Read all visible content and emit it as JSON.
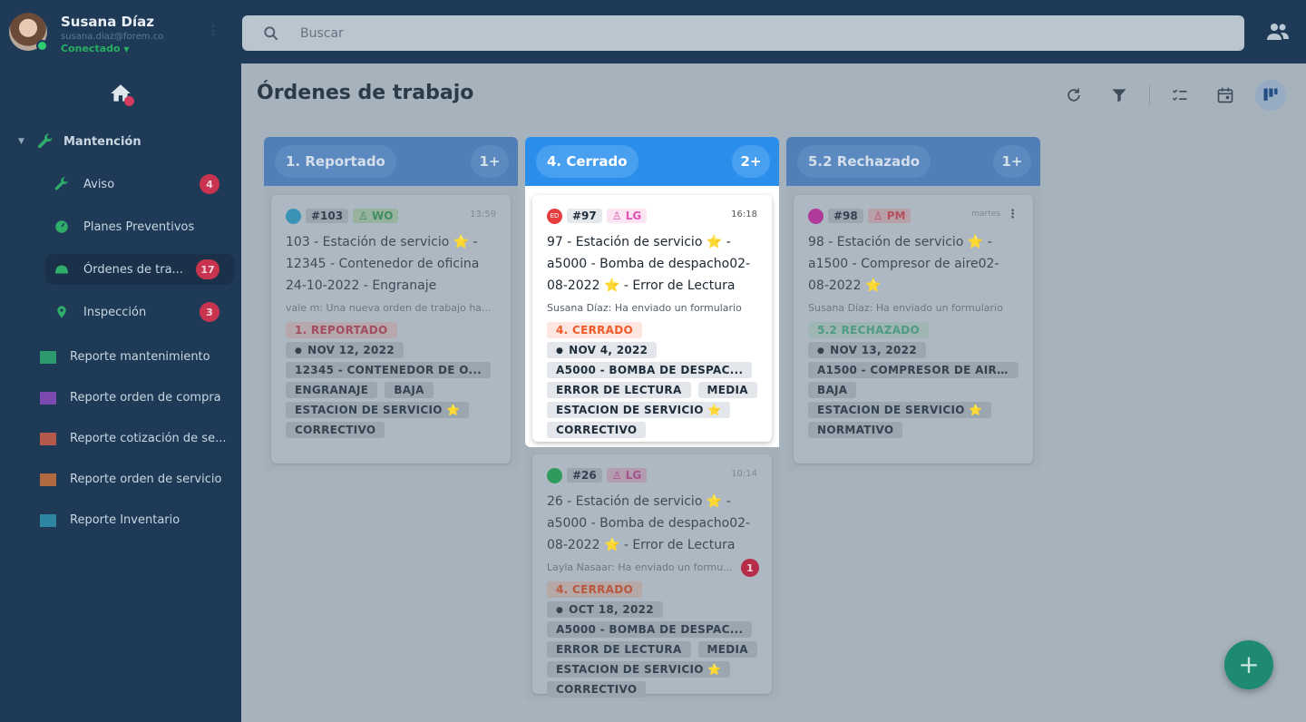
{
  "user": {
    "name": "Susana Díaz",
    "email": "susana.diaz@forem.co",
    "status": "Conectado"
  },
  "nav": {
    "section": "Mantención",
    "items": [
      {
        "label": "Aviso",
        "badge": "4"
      },
      {
        "label": "Planes Preventivos",
        "badge": ""
      },
      {
        "label": "Órdenes de tra...",
        "badge": "17"
      },
      {
        "label": "Inspección",
        "badge": "3"
      }
    ],
    "reports": [
      {
        "label": "Reporte mantenimiento",
        "color": "#2f9a6e"
      },
      {
        "label": "Reporte orden de compra",
        "color": "#7a4ab0"
      },
      {
        "label": "Reporte cotización de se...",
        "color": "#b35a4d"
      },
      {
        "label": "Reporte orden de servicio",
        "color": "#b06a3f"
      },
      {
        "label": "Reporte Inventario",
        "color": "#2f86a3"
      }
    ]
  },
  "search": {
    "placeholder": "Buscar"
  },
  "page": {
    "title": "Órdenes de trabajo"
  },
  "toolbar": {
    "icons": [
      "refresh-icon",
      "filter-icon",
      "list-icon",
      "calendar-icon",
      "kanban-icon"
    ]
  },
  "columns": [
    {
      "title": "1. Reportado",
      "count": "1+",
      "cards": [
        {
          "avatar_color": "#3a92b5",
          "avatar_text": "",
          "number": "#103",
          "who": "WO",
          "time": "13:59",
          "title": "103 - Estación de servicio ⭐ - 12345 - Contenedor de oficina 24-10-2022 - Engranaje",
          "message": "vale m: Una nueva orden de trabajo ha...",
          "state": "1. REPORTADO",
          "date": "NOV 12, 2022",
          "tags": [
            "12345 - CONTENEDOR DE O...",
            "ENGRANAJE",
            "BAJA",
            "ESTACION DE SERVICIO ⭐",
            "CORRECTIVO"
          ]
        }
      ]
    },
    {
      "title": "4. Cerrado",
      "count": "2+",
      "cards": [
        {
          "avatar_color": "#e53c3c",
          "avatar_text": "ED",
          "number": "#97",
          "who": "LG",
          "time": "16:18",
          "title": "97 - Estación de servicio ⭐ - a5000 - Bomba de despacho02-08-2022 ⭐ - Error de Lectura",
          "message": "Susana Díaz: Ha enviado un formulario",
          "state": "4. CERRADO",
          "date": "NOV 4, 2022",
          "tags": [
            "A5000 - BOMBA DE DESPAC...",
            "ERROR DE LECTURA",
            "MEDIA",
            "ESTACION DE SERVICIO ⭐",
            "CORRECTIVO"
          ]
        },
        {
          "avatar_color": "#2f9a5e",
          "avatar_text": "",
          "number": "#26",
          "who": "LG",
          "time": "10:14",
          "title": "26 - Estación de servicio ⭐ - a5000 - Bomba de despacho02-08-2022 ⭐ - Error de Lectura",
          "message": "Layla Nasaar: Ha enviado un formu...",
          "message_badge": "1",
          "state": "4. CERRADO",
          "date": "OCT 18, 2022",
          "tags": [
            "A5000 - BOMBA DE DESPAC...",
            "ERROR DE LECTURA",
            "MEDIA",
            "ESTACION DE SERVICIO ⭐",
            "CORRECTIVO"
          ]
        }
      ]
    },
    {
      "title": "5.2 Rechazado",
      "count": "1+",
      "cards": [
        {
          "avatar_color": "#b03a9a",
          "avatar_text": "",
          "number": "#98",
          "who": "PM",
          "time": "martes",
          "title": "98 - Estación de servicio ⭐ - a1500 - Compresor de aire02-08-2022 ⭐",
          "message": "Susana Díaz: Ha enviado un formulario",
          "state": "5.2 RECHAZADO",
          "date": "NOV 13, 2022",
          "tags": [
            "A1500 - COMPRESOR DE AIR...",
            "BAJA",
            "ESTACION DE SERVICIO ⭐",
            "NORMATIVO"
          ]
        }
      ]
    }
  ],
  "fab": {
    "label": "+"
  }
}
